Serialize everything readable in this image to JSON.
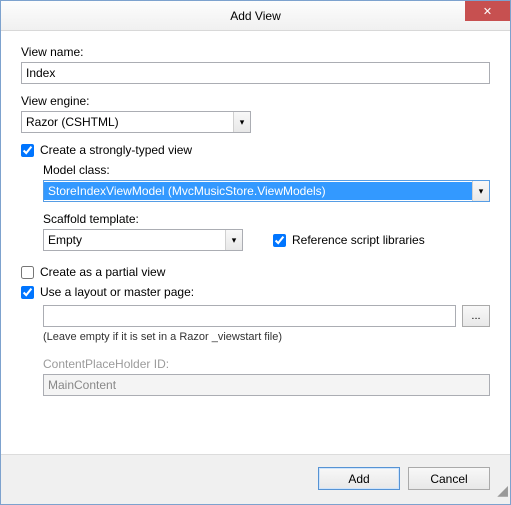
{
  "window": {
    "title": "Add View"
  },
  "viewName": {
    "label": "View name:",
    "value": "Index"
  },
  "viewEngine": {
    "label": "View engine:",
    "value": "Razor (CSHTML)"
  },
  "stronglyTyped": {
    "label": "Create a strongly-typed view",
    "checked": true
  },
  "modelClass": {
    "label": "Model class:",
    "value": "StoreIndexViewModel (MvcMusicStore.ViewModels)"
  },
  "scaffold": {
    "label": "Scaffold template:",
    "value": "Empty"
  },
  "refScript": {
    "label": "Reference script libraries",
    "checked": true
  },
  "partial": {
    "label": "Create as a partial view",
    "checked": false
  },
  "layout": {
    "label": "Use a layout or master page:",
    "checked": true,
    "path": "",
    "browse": "...",
    "hint": "(Leave empty if it is set in a Razor _viewstart file)"
  },
  "placeholder": {
    "label": "ContentPlaceHolder ID:",
    "value": "MainContent"
  },
  "buttons": {
    "add": "Add",
    "cancel": "Cancel"
  }
}
